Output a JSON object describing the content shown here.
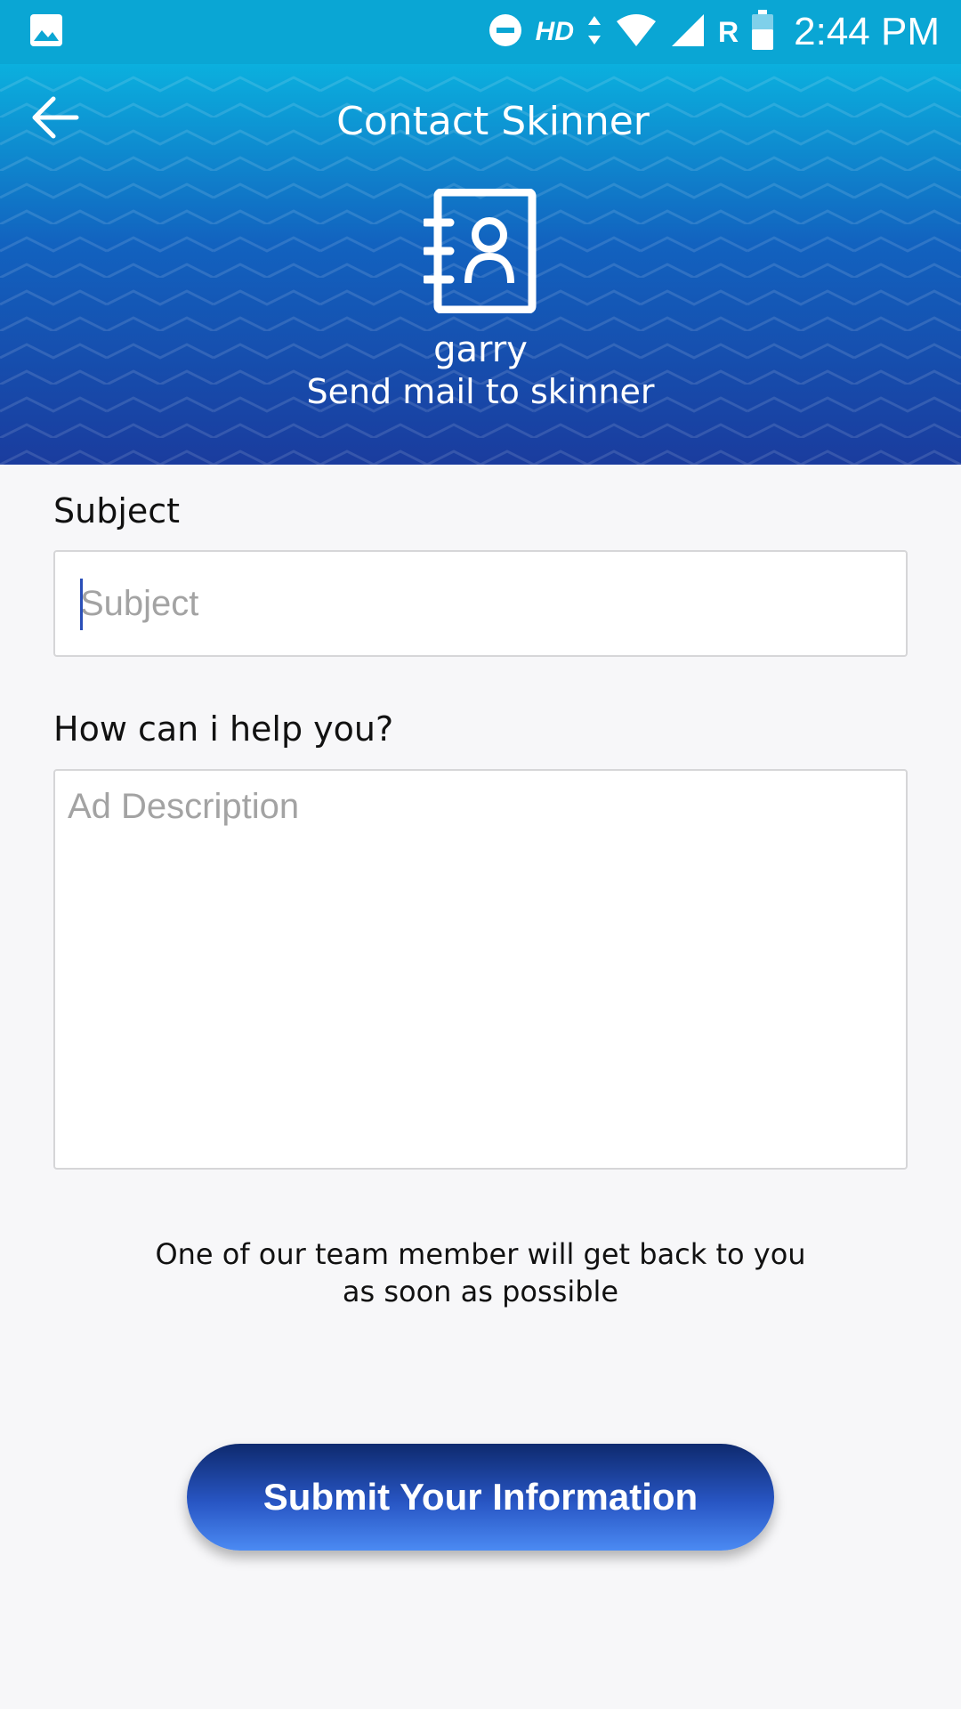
{
  "status_bar": {
    "time": "2:44 PM",
    "network_label": "HD",
    "roaming_label": "R",
    "icons": [
      "image-icon",
      "do-not-disturb-icon",
      "data-arrows-icon",
      "wifi-icon",
      "signal-icon",
      "battery-icon"
    ]
  },
  "header": {
    "title": "Contact Skinner",
    "back_icon": "arrow-left-icon",
    "contact_icon": "contact-book-icon",
    "user_name": "garry",
    "subtitle": "Send mail to skinner"
  },
  "form": {
    "subject_label": "Subject",
    "subject_placeholder": "Subject",
    "subject_value": "",
    "help_label": "How can i help you?",
    "description_placeholder": "Ad Description",
    "description_value": "",
    "note": "One of our team member will get back to you as soon as possible",
    "submit_label": "Submit Your Information"
  },
  "colors": {
    "status_bar": "#0aa6d4",
    "header_top": "#0bb0de",
    "header_bottom": "#1a3c9e",
    "button_top": "#0e2a6e",
    "button_bottom": "#4b8af3",
    "caret": "#2a4fb8"
  }
}
